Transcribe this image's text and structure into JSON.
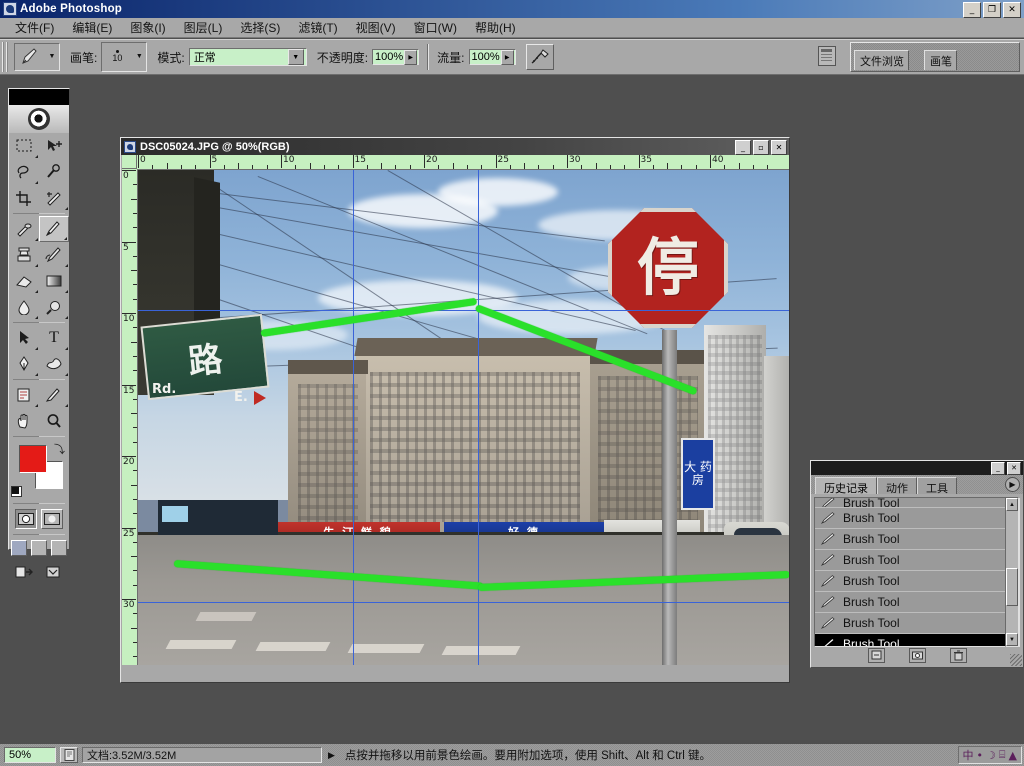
{
  "app": {
    "title": "Adobe Photoshop",
    "icon": "photoshop-icon",
    "window_buttons": {
      "minimize": "_",
      "restore": "❐",
      "close": "✕"
    }
  },
  "menu": {
    "items": [
      {
        "label": "文件(F)"
      },
      {
        "label": "编辑(E)"
      },
      {
        "label": "图象(I)"
      },
      {
        "label": "图层(L)"
      },
      {
        "label": "选择(S)"
      },
      {
        "label": "滤镜(T)"
      },
      {
        "label": "视图(V)"
      },
      {
        "label": "窗口(W)"
      },
      {
        "label": "帮助(H)"
      }
    ]
  },
  "options_bar": {
    "brush_label": "画笔:",
    "brush_size": "10",
    "mode_label": "模式:",
    "mode_value": "正常",
    "opacity_label": "不透明度:",
    "opacity_value": "100%",
    "flow_label": "流量:",
    "flow_value": "100%",
    "airbrush_icon": "airbrush-icon",
    "tool_icon": "brush-tool-icon"
  },
  "palette_well": {
    "tabs": [
      {
        "label": "文件浏览"
      },
      {
        "label": "画笔"
      }
    ]
  },
  "toolbox": {
    "tools": [
      {
        "name": "marquee-tool",
        "icon": "marquee-icon"
      },
      {
        "name": "move-tool",
        "icon": "move-icon"
      },
      {
        "name": "lasso-tool",
        "icon": "lasso-icon"
      },
      {
        "name": "magic-wand-tool",
        "icon": "magic-wand-icon"
      },
      {
        "name": "crop-tool",
        "icon": "crop-icon"
      },
      {
        "name": "slice-tool",
        "icon": "slice-icon"
      },
      {
        "name": "healing-brush-tool",
        "icon": "healing-brush-icon"
      },
      {
        "name": "brush-tool",
        "icon": "paintbrush-icon",
        "selected": true
      },
      {
        "name": "clone-stamp-tool",
        "icon": "stamp-icon"
      },
      {
        "name": "history-brush-tool",
        "icon": "history-brush-icon"
      },
      {
        "name": "eraser-tool",
        "icon": "eraser-icon"
      },
      {
        "name": "gradient-tool",
        "icon": "gradient-icon"
      },
      {
        "name": "blur-tool",
        "icon": "blur-drop-icon"
      },
      {
        "name": "dodge-tool",
        "icon": "dodge-icon"
      },
      {
        "name": "path-selection-tool",
        "icon": "path-arrow-icon"
      },
      {
        "name": "type-tool",
        "icon": "type-T-icon"
      },
      {
        "name": "pen-tool",
        "icon": "pen-icon"
      },
      {
        "name": "shape-tool",
        "icon": "custom-shape-icon"
      },
      {
        "name": "notes-tool",
        "icon": "notes-icon"
      },
      {
        "name": "eyedropper-tool",
        "icon": "eyedropper-icon"
      },
      {
        "name": "hand-tool",
        "icon": "hand-icon"
      },
      {
        "name": "zoom-tool",
        "icon": "magnifier-icon"
      }
    ],
    "colors": {
      "foreground": "#e41b17",
      "background": "#ffffff",
      "swap_icon": "swap-colors-icon",
      "default_icon": "default-colors-icon"
    },
    "quickmask": [
      {
        "name": "standard-mode-button",
        "icon": "standard-mode-icon",
        "active": true
      },
      {
        "name": "quick-mask-mode-button",
        "icon": "quick-mask-icon",
        "active": false
      }
    ],
    "screen_modes": [
      {
        "name": "standard-screen-mode",
        "active": true
      },
      {
        "name": "full-screen-menubar-mode",
        "active": false
      },
      {
        "name": "full-screen-mode",
        "active": false
      }
    ],
    "jump_to": {
      "name": "jump-to-imageready",
      "icon": "imageready-icon"
    }
  },
  "document": {
    "title": "DSC05024.JPG @ 50%(RGB)",
    "window_buttons": {
      "minimize": "_",
      "maximize": "▫",
      "close": "✕"
    },
    "ruler_horizontal": [
      "0",
      "5",
      "10",
      "15",
      "20",
      "25",
      "30",
      "35",
      "40"
    ],
    "ruler_vertical": [
      "0",
      "5",
      "10",
      "15",
      "20",
      "25",
      "30"
    ],
    "image": {
      "stop_sign_text": "停",
      "street_sign_cn": "路",
      "street_sign_en": "Rd.",
      "street_sign_dir": "E.",
      "banner_red_text": "生 汀 鲜 貌",
      "banner_blue_text": "好 德",
      "bluebox_text": "大\n药\n房"
    },
    "guides": {
      "color": "#3a63d8",
      "vertical": [
        215,
        340
      ],
      "horizontal": [
        140,
        432
      ]
    },
    "brush_strokes": {
      "color": "#2ae02a",
      "count": 4
    }
  },
  "history_palette": {
    "window_buttons": {
      "minimize": "_",
      "close": "✕"
    },
    "tabs": [
      {
        "label": "历史记录",
        "active": true
      },
      {
        "label": "动作",
        "active": false
      },
      {
        "label": "工具",
        "active": false
      }
    ],
    "menu_icon": "palette-menu-icon",
    "states": [
      {
        "label": "Brush Tool",
        "selected": false,
        "partial": true
      },
      {
        "label": "Brush Tool",
        "selected": false
      },
      {
        "label": "Brush Tool",
        "selected": false
      },
      {
        "label": "Brush Tool",
        "selected": false
      },
      {
        "label": "Brush Tool",
        "selected": false
      },
      {
        "label": "Brush Tool",
        "selected": false
      },
      {
        "label": "Brush Tool",
        "selected": false
      },
      {
        "label": "Brush Tool",
        "selected": true
      }
    ],
    "footer_buttons": [
      {
        "name": "new-document-from-state-button",
        "icon": "new-doc-icon"
      },
      {
        "name": "new-snapshot-button",
        "icon": "snapshot-icon"
      },
      {
        "name": "delete-state-button",
        "icon": "trash-icon"
      }
    ],
    "scroll_up_icon": "scroll-up-arrow",
    "scroll_down_icon": "scroll-down-arrow"
  },
  "status_bar": {
    "zoom": "50%",
    "preview_icon": "page-preview-icon",
    "doc_size": "文档:3.52M/3.52M",
    "expand_arrow": "▶",
    "hint": "点按并拖移以用前景色绘画。要用附加选项，使用 Shift、Alt 和 Ctrl 键。",
    "tray_items": [
      "中",
      "•",
      "☽",
      "⌸",
      "▲"
    ]
  }
}
